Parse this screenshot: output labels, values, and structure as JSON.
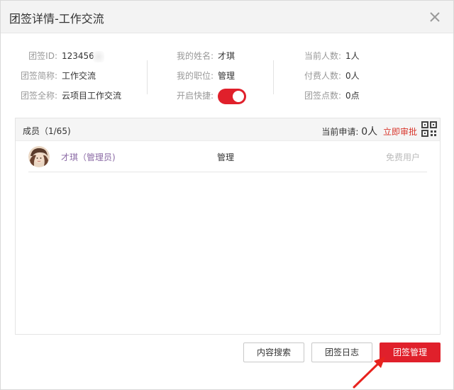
{
  "dialog": {
    "title": "团签详情-工作交流"
  },
  "team_info": {
    "id_label": "团签ID:",
    "id_value": "123456",
    "short_name_label": "团签简称:",
    "short_name_value": "工作交流",
    "full_name_label": "团签全称:",
    "full_name_value": "云项目工作交流",
    "my_name_label": "我的姓名:",
    "my_name_value": "才琪",
    "my_role_label": "我的职位:",
    "my_role_value": "管理",
    "quick_label": "开启快捷:",
    "quick_enabled": true,
    "current_count_label": "当前人数:",
    "current_count_value": "1人",
    "paid_count_label": "付费人数:",
    "paid_count_value": "0人",
    "points_label": "团签点数:",
    "points_value": "0点"
  },
  "members": {
    "header_title": "成员（1/65)",
    "pending_label": "当前申请:",
    "pending_count": "0人",
    "approve_link": "立即审批",
    "rows": [
      {
        "name": "才琪（管理员)",
        "role": "管理",
        "type": "免费用户"
      }
    ]
  },
  "buttons": {
    "search": "内容搜索",
    "log": "团签日志",
    "manage": "团签管理"
  },
  "colors": {
    "accent": "#e0202b",
    "toggle_on": "#e0202b",
    "admin_name": "#8b6aa5",
    "annotation_arrow": "#e8231e"
  },
  "icons": {
    "close": "close-icon",
    "qr": "qr-code-icon",
    "avatar": "avatar"
  }
}
